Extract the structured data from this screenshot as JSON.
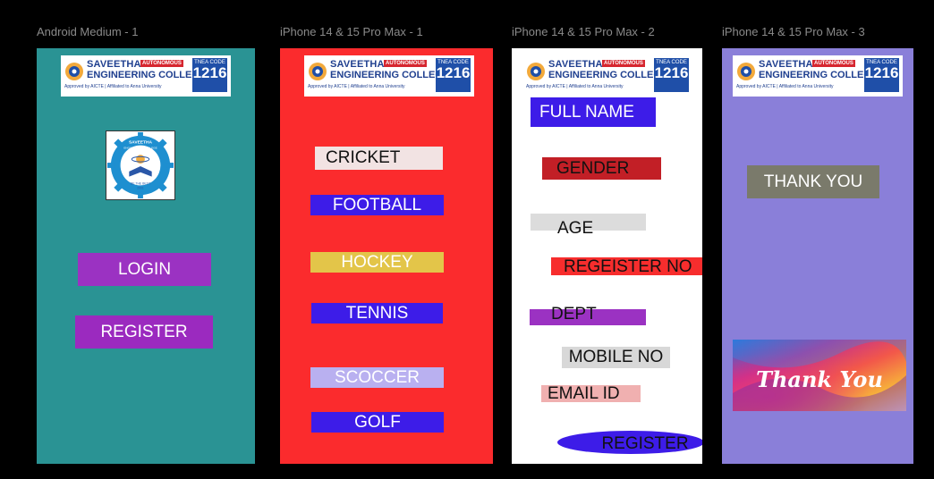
{
  "frames": [
    {
      "label": "Android Medium - 1",
      "background": "#2a9394",
      "buttons": [
        {
          "label": "LOGIN",
          "bg": "#9b32c2",
          "fg": "#ffffff"
        },
        {
          "label": "REGISTER",
          "bg": "#9b2abf",
          "fg": "#ffffff"
        }
      ]
    },
    {
      "label": "iPhone 14 & 15 Pro Max - 1",
      "background": "#fb2b2d",
      "buttons": [
        {
          "label": "CRICKET",
          "bg": "#f2e3e3",
          "fg": "#111111"
        },
        {
          "label": "FOOTBALL",
          "bg": "#3d1ce8",
          "fg": "#ffffff"
        },
        {
          "label": "HOCKEY",
          "bg": "#e3c549",
          "fg": "#ffffff"
        },
        {
          "label": "TENNIS",
          "bg": "#3d1ce8",
          "fg": "#ffffff"
        },
        {
          "label": "SCOCCER",
          "bg": "#b9b0f0",
          "fg": "#ffffff"
        },
        {
          "label": "GOLF",
          "bg": "#3d1ce8",
          "fg": "#ffffff"
        }
      ]
    },
    {
      "label": "iPhone 14 & 15 Pro Max - 2",
      "background": "#ffffff",
      "fields": [
        {
          "label": "FULL  NAME",
          "bg": "#3d1ce8",
          "fg": "#ffffff"
        },
        {
          "label": "GENDER",
          "bg": "#c21f26",
          "fg": "#111111"
        },
        {
          "label": "AGE",
          "bg": "#dcdcdc",
          "fg": "#111111"
        },
        {
          "label": "REGEISTER NO",
          "bg": "#f72d2d",
          "fg": "#111111"
        },
        {
          "label": "DEPT",
          "bg": "#9b32c2",
          "fg": "#111111"
        },
        {
          "label": "MOBILE NO",
          "bg": "#d8d8d8",
          "fg": "#111111"
        },
        {
          "label": "EMAIL  ID",
          "bg": "#f0b0b0",
          "fg": "#111111"
        },
        {
          "label": "REGISTER",
          "bg": "#3d1ce8",
          "fg": "#111111"
        }
      ]
    },
    {
      "label": "iPhone 14 & 15 Pro Max - 3",
      "background": "#8a7fd9",
      "thank_you_label": "THANK YOU",
      "thank_you_bg": "#7a7a6b",
      "thank_you_fg": "#ffffff",
      "card_text": "Thank You"
    }
  ],
  "banner": {
    "line1": "SAVEETHA",
    "badge": "AUTONOMOUS",
    "line2": "ENGINEERING COLLEGE",
    "sub": "Approved by AICTE  |  Affiliated to Anna University",
    "tnea_label": "TNEA CODE",
    "tnea_code": "1216"
  },
  "emblem": {
    "top": "SAVEETHA",
    "sub": "ENGINEERING COLLEGE",
    "motto": "BE THE BEST",
    "year": "2001"
  }
}
